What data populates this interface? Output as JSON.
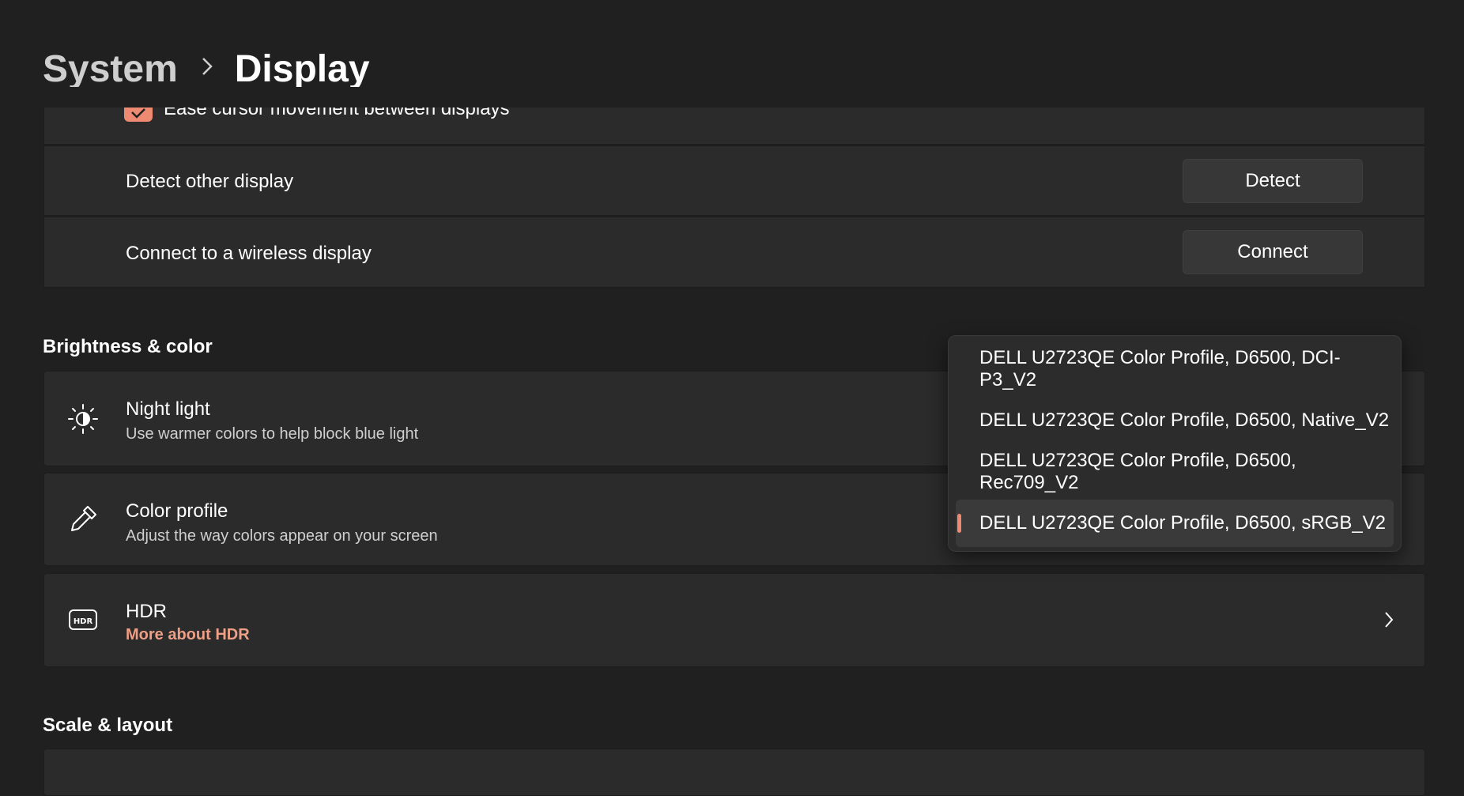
{
  "breadcrumb": {
    "parent": "System",
    "current": "Display"
  },
  "multiple_displays": {
    "ease_cursor_label": "Ease cursor movement between displays",
    "ease_cursor_checked": true,
    "detect_label": "Detect other display",
    "detect_button": "Detect",
    "wireless_label": "Connect to a wireless display",
    "connect_button": "Connect"
  },
  "brightness_color": {
    "section_title": "Brightness & color",
    "night_light": {
      "title": "Night light",
      "subtitle": "Use warmer colors to help block blue light",
      "icon": "night-light-icon"
    },
    "color_profile": {
      "title": "Color profile",
      "subtitle": "Adjust the way colors appear on your screen",
      "icon": "eyedropper-icon"
    },
    "hdr": {
      "title": "HDR",
      "link": "More about HDR",
      "icon": "hdr-icon"
    }
  },
  "color_profile_dropdown": {
    "options": [
      "DELL U2723QE Color Profile, D6500, DCI-P3_V2",
      "DELL U2723QE Color Profile, D6500, Native_V2",
      "DELL U2723QE Color Profile, D6500, Rec709_V2",
      "DELL U2723QE Color Profile, D6500, sRGB_V2"
    ],
    "selected_index": 3
  },
  "scale_layout": {
    "section_title": "Scale & layout"
  },
  "colors": {
    "accent": "#ee8a72",
    "link": "#ee9f86",
    "background": "#202020",
    "card": "#2b2b2b"
  }
}
